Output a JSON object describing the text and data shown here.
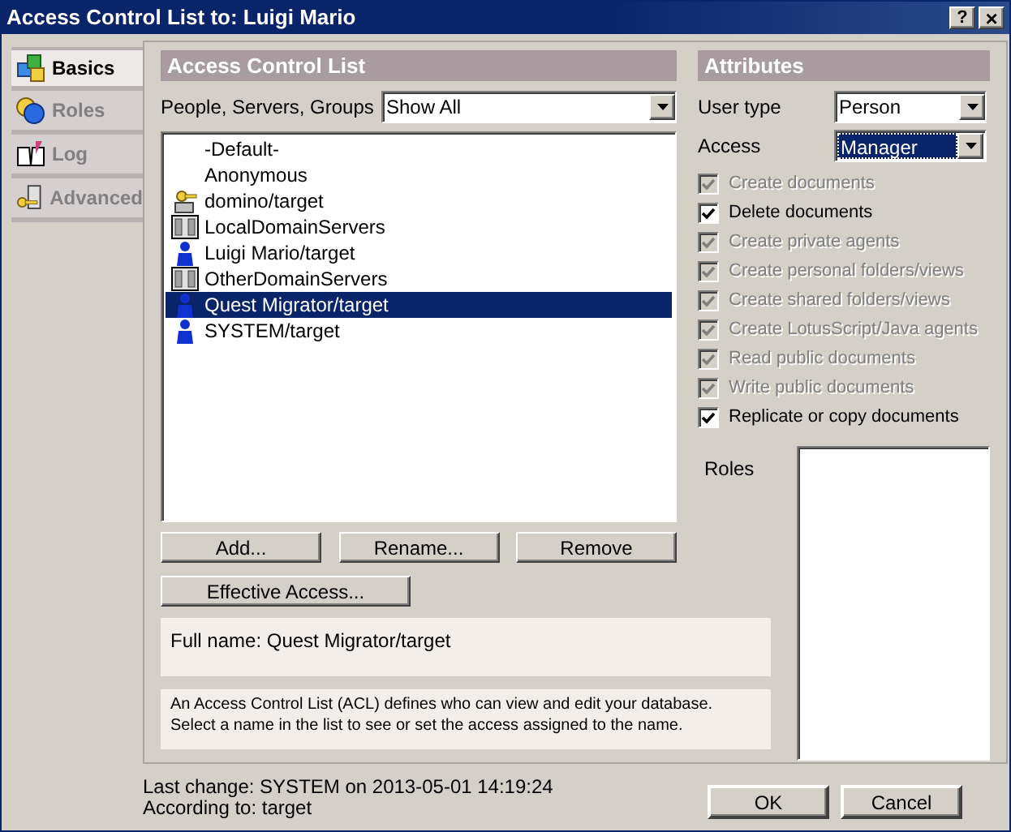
{
  "window": {
    "title": "Access Control List to: Luigi Mario",
    "help_button": "?",
    "close_button": "×"
  },
  "sidebar": {
    "items": [
      {
        "label": "Basics",
        "kind": "basics",
        "selected": true
      },
      {
        "label": "Roles",
        "kind": "roles",
        "selected": false
      },
      {
        "label": "Log",
        "kind": "log",
        "selected": false
      },
      {
        "label": "Advanced",
        "kind": "advanced",
        "selected": false
      }
    ]
  },
  "acl": {
    "header": "Access Control List",
    "filter_label": "People, Servers, Groups",
    "filter_value": "Show All",
    "entries": [
      {
        "name": "-Default-",
        "kind": "none",
        "selected": false
      },
      {
        "name": "Anonymous",
        "kind": "none",
        "selected": false
      },
      {
        "name": "domino/target",
        "kind": "server",
        "selected": false
      },
      {
        "name": "LocalDomainServers",
        "kind": "group",
        "selected": false
      },
      {
        "name": "Luigi Mario/target",
        "kind": "person",
        "selected": false
      },
      {
        "name": "OtherDomainServers",
        "kind": "group",
        "selected": false
      },
      {
        "name": "Quest Migrator/target",
        "kind": "person",
        "selected": true
      },
      {
        "name": "SYSTEM/target",
        "kind": "person",
        "selected": false
      }
    ],
    "buttons": [
      "Add...",
      "Rename...",
      "Remove"
    ],
    "effective_access_button": "Effective Access...",
    "full_name": "Full name: Quest Migrator/target",
    "help_text": "An Access Control List (ACL) defines who can view and edit your database. Select a name in the list to see or set the access assigned to the name."
  },
  "attributes": {
    "header": "Attributes",
    "user_type": {
      "label": "User type",
      "value": "Person"
    },
    "access": {
      "label": "Access",
      "value": "Manager"
    },
    "permissions": [
      {
        "label": "Create documents",
        "checked": true,
        "disabled": true
      },
      {
        "label": "Delete documents",
        "checked": true,
        "disabled": false
      },
      {
        "label": "Create private agents",
        "checked": true,
        "disabled": true
      },
      {
        "label": "Create personal folders/views",
        "checked": true,
        "disabled": true
      },
      {
        "label": "Create shared folders/views",
        "checked": true,
        "disabled": true
      },
      {
        "label": "Create LotusScript/Java agents",
        "checked": true,
        "disabled": true
      },
      {
        "label": "Read public documents",
        "checked": true,
        "disabled": true
      },
      {
        "label": "Write public documents",
        "checked": true,
        "disabled": true
      },
      {
        "label": "Replicate or copy documents",
        "checked": true,
        "disabled": false
      }
    ],
    "roles_label": "Roles"
  },
  "status": {
    "last_change": "Last change: SYSTEM on 2013-05-01 14:19:24",
    "according_to": "According to: target"
  },
  "buttons": [
    "OK",
    "Cancel"
  ]
}
